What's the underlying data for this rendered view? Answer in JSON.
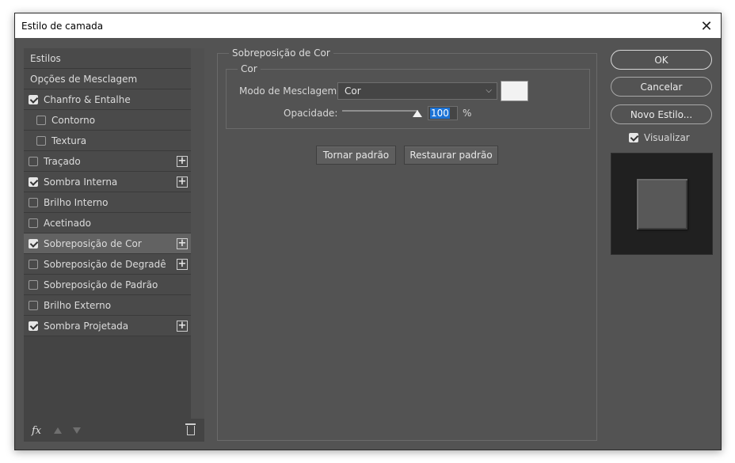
{
  "window": {
    "title": "Estilo de camada"
  },
  "sidebar": {
    "items": [
      {
        "label": "Estilos",
        "type": "header"
      },
      {
        "label": "Opções de Mesclagem",
        "type": "header"
      },
      {
        "label": "Chanfro & Entalhe",
        "checked": true,
        "plus": false,
        "indent": false,
        "selected": false
      },
      {
        "label": "Contorno",
        "checked": false,
        "plus": false,
        "indent": true,
        "selected": false
      },
      {
        "label": "Textura",
        "checked": false,
        "plus": false,
        "indent": true,
        "selected": false
      },
      {
        "label": "Traçado",
        "checked": false,
        "plus": true,
        "indent": false,
        "selected": false
      },
      {
        "label": "Sombra Interna",
        "checked": true,
        "plus": true,
        "indent": false,
        "selected": false
      },
      {
        "label": "Brilho Interno",
        "checked": false,
        "plus": false,
        "indent": false,
        "selected": false
      },
      {
        "label": "Acetinado",
        "checked": false,
        "plus": false,
        "indent": false,
        "selected": false
      },
      {
        "label": "Sobreposição de Cor",
        "checked": true,
        "plus": true,
        "indent": false,
        "selected": true
      },
      {
        "label": "Sobreposição de Degradê",
        "checked": false,
        "plus": true,
        "indent": false,
        "selected": false
      },
      {
        "label": "Sobreposição de Padrão",
        "checked": false,
        "plus": false,
        "indent": false,
        "selected": false
      },
      {
        "label": "Brilho Externo",
        "checked": false,
        "plus": false,
        "indent": false,
        "selected": false
      },
      {
        "label": "Sombra Projetada",
        "checked": true,
        "plus": true,
        "indent": false,
        "selected": false
      }
    ],
    "tools": {
      "fx_label": "fx"
    }
  },
  "panel": {
    "group_title": "Sobreposição de Cor",
    "subgroup_title": "Cor",
    "blend_mode_label": "Modo de Mesclagem:",
    "blend_mode_value": "Cor",
    "swatch_color": "#f2f2f2",
    "opacity_label": "Opacidade:",
    "opacity_value": "100",
    "opacity_unit": "%",
    "opacity_fraction": 1.0,
    "make_default_label": "Tornar padrão",
    "reset_default_label": "Restaurar padrão"
  },
  "actions": {
    "ok_label": "OK",
    "cancel_label": "Cancelar",
    "new_style_label": "Novo Estilo...",
    "preview_label": "Visualizar",
    "preview_checked": true
  }
}
